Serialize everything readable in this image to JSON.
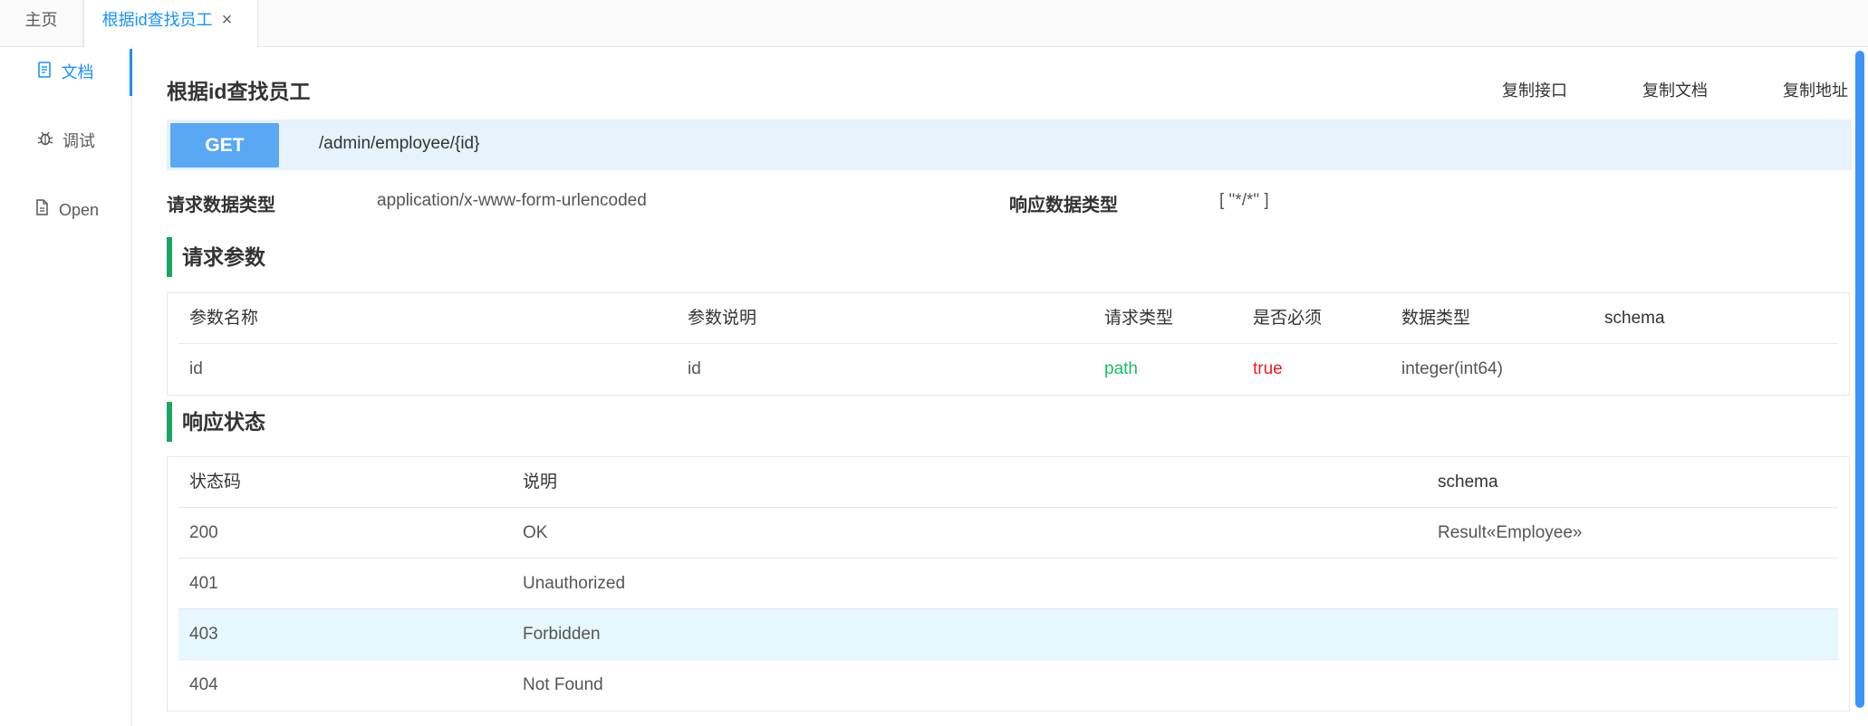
{
  "tabs": {
    "home_label": "主页",
    "active_label": "根据id查找员工",
    "close_glyph": "×"
  },
  "sidebar": {
    "items": [
      {
        "label": "文档",
        "icon": "document-icon"
      },
      {
        "label": "调试",
        "icon": "bug-icon"
      },
      {
        "label": "Open",
        "icon": "file-icon"
      }
    ]
  },
  "page": {
    "title": "根据id查找员工",
    "copy_api": "复制接口",
    "copy_doc": "复制文档",
    "copy_url": "复制地址"
  },
  "request": {
    "method": "GET",
    "path": "/admin/employee/{id}",
    "req_type_label": "请求数据类型",
    "req_type_value": "application/x-www-form-urlencoded",
    "resp_type_label": "响应数据类型",
    "resp_type_value": "[ \"*/*\" ]"
  },
  "params": {
    "heading": "请求参数",
    "columns": [
      "参数名称",
      "参数说明",
      "请求类型",
      "是否必须",
      "数据类型",
      "schema"
    ],
    "rows": [
      {
        "name": "id",
        "desc": "id",
        "in": "path",
        "required": "true",
        "type": "integer(int64)",
        "schema": ""
      }
    ]
  },
  "responses": {
    "heading": "响应状态",
    "columns": [
      "状态码",
      "说明",
      "schema"
    ],
    "rows": [
      {
        "code": "200",
        "desc": "OK",
        "schema": "Result«Employee»"
      },
      {
        "code": "401",
        "desc": "Unauthorized",
        "schema": ""
      },
      {
        "code": "403",
        "desc": "Forbidden",
        "schema": ""
      },
      {
        "code": "404",
        "desc": "Not Found",
        "schema": ""
      }
    ]
  },
  "colors": {
    "accent": "#1890ff",
    "get_button": "#5aa8f4",
    "section_bar": "#19a663",
    "path_green": "#19be6b",
    "required_red": "#ed1c24"
  }
}
